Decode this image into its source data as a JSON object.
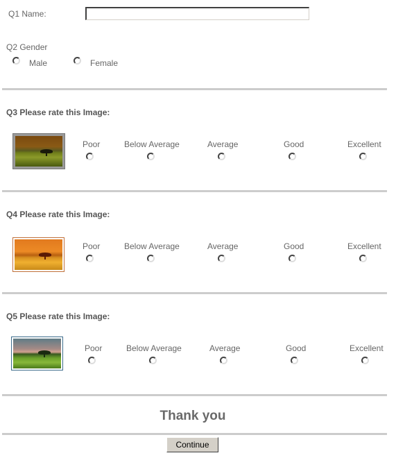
{
  "q1": {
    "label": "Q1 Name:",
    "value": "",
    "placeholder": ""
  },
  "q2": {
    "label": "Q2 Gender",
    "options": [
      "Male",
      "Female"
    ]
  },
  "rating_options": [
    "Poor",
    "Below Average",
    "Average",
    "Good",
    "Excellent"
  ],
  "q3": {
    "title": "Q3 Please rate this Image:",
    "image": "sepia-tree-landscape"
  },
  "q4": {
    "title": "Q4 Please rate this Image:",
    "image": "orange-tree-landscape"
  },
  "q5": {
    "title": "Q5 Please rate this Image:",
    "image": "green-tree-landscape"
  },
  "footer": {
    "thanks": "Thank you",
    "continue_label": "Continue"
  }
}
